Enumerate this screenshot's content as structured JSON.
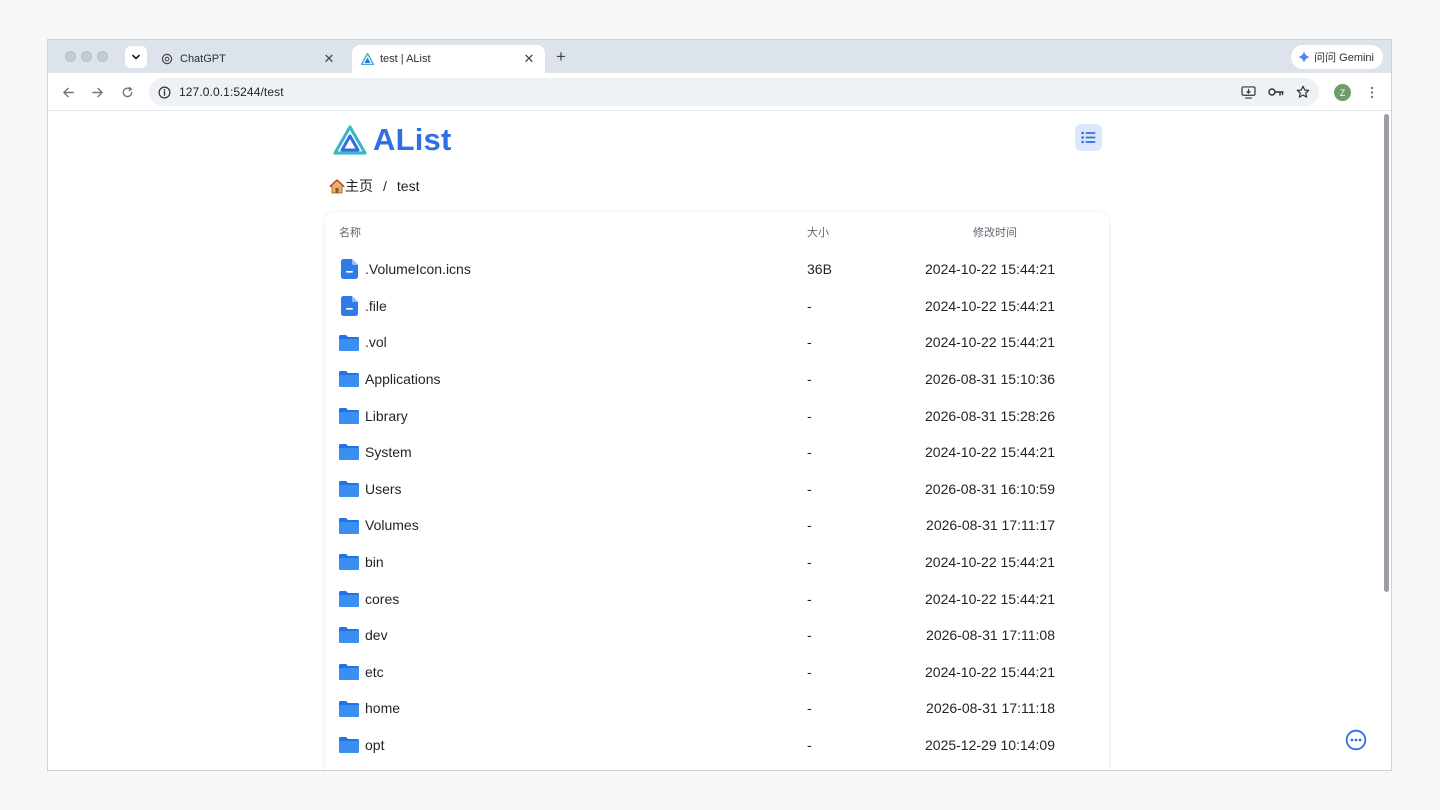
{
  "tabs": [
    {
      "title": "ChatGPT",
      "active": false
    },
    {
      "title": "test | AList",
      "active": true
    }
  ],
  "gemini_label": "问问 Gemini",
  "url": "127.0.0.1:5244/test",
  "profile_initial": "Z",
  "app": {
    "name": "AList",
    "accent": "#2f6fe4"
  },
  "breadcrumb": {
    "home": "主页",
    "separator": "/",
    "current": "test"
  },
  "table": {
    "headers": {
      "name": "名称",
      "size": "大小",
      "modified": "修改时间"
    },
    "rows": [
      {
        "type": "file",
        "name": ".VolumeIcon.icns",
        "size": "36B",
        "modified": "2024-10-22 15:44:21"
      },
      {
        "type": "file",
        "name": ".file",
        "size": "-",
        "modified": "2024-10-22 15:44:21"
      },
      {
        "type": "folder",
        "name": ".vol",
        "size": "-",
        "modified": "2024-10-22 15:44:21"
      },
      {
        "type": "folder",
        "name": "Applications",
        "size": "-",
        "modified": "2026-08-31 15:10:36"
      },
      {
        "type": "folder",
        "name": "Library",
        "size": "-",
        "modified": "2026-08-31 15:28:26"
      },
      {
        "type": "folder",
        "name": "System",
        "size": "-",
        "modified": "2024-10-22 15:44:21"
      },
      {
        "type": "folder",
        "name": "Users",
        "size": "-",
        "modified": "2026-08-31 16:10:59"
      },
      {
        "type": "folder",
        "name": "Volumes",
        "size": "-",
        "modified": "2026-08-31 17:11:17"
      },
      {
        "type": "folder",
        "name": "bin",
        "size": "-",
        "modified": "2024-10-22 15:44:21"
      },
      {
        "type": "folder",
        "name": "cores",
        "size": "-",
        "modified": "2024-10-22 15:44:21"
      },
      {
        "type": "folder",
        "name": "dev",
        "size": "-",
        "modified": "2026-08-31 17:11:08"
      },
      {
        "type": "folder",
        "name": "etc",
        "size": "-",
        "modified": "2024-10-22 15:44:21"
      },
      {
        "type": "folder",
        "name": "home",
        "size": "-",
        "modified": "2026-08-31 17:11:18"
      },
      {
        "type": "folder",
        "name": "opt",
        "size": "-",
        "modified": "2025-12-29 10:14:09"
      }
    ]
  },
  "icons": {
    "file": "file-icon",
    "folder": "folder-icon",
    "layout": "list-layout-icon",
    "fab": "more-options-icon"
  }
}
